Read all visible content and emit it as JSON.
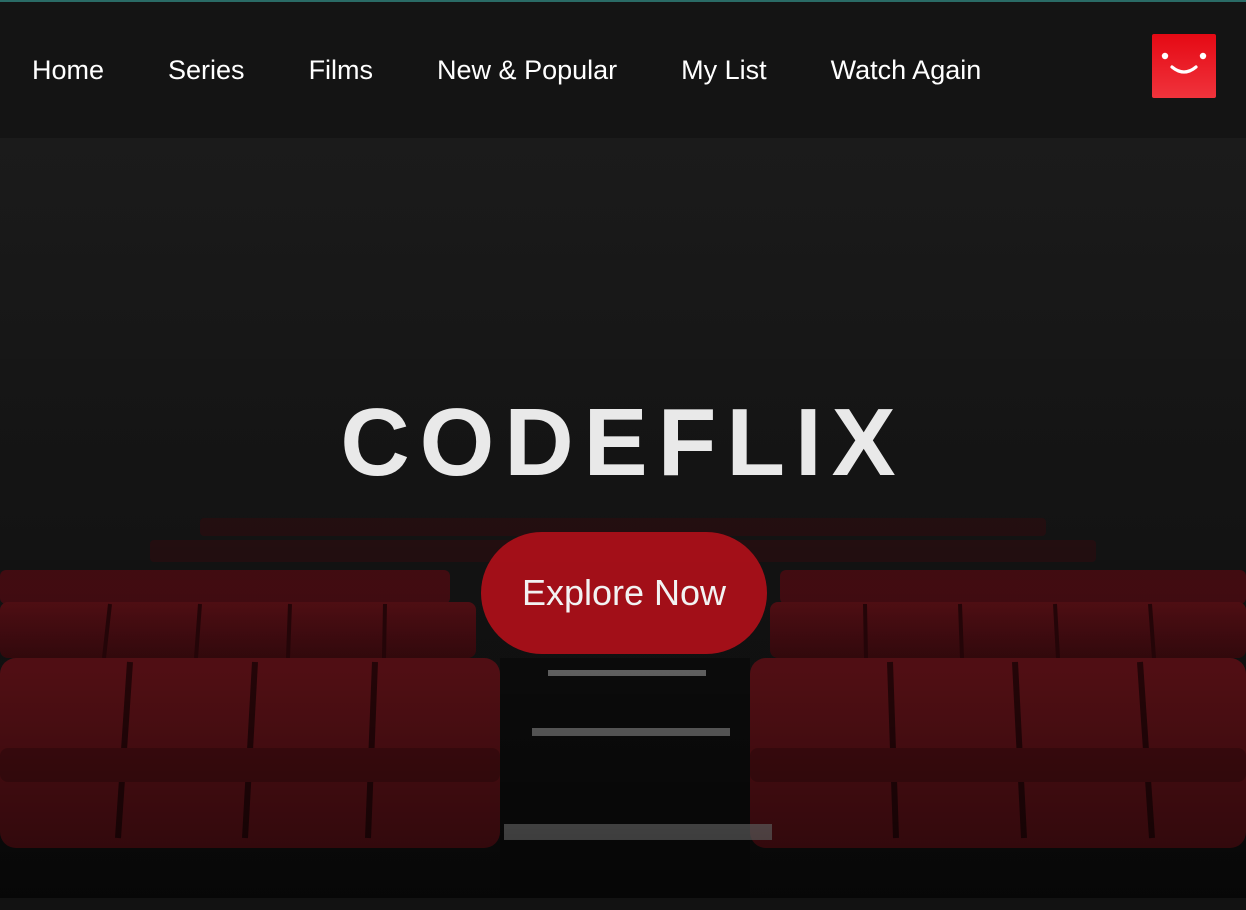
{
  "nav": {
    "links": [
      "Home",
      "Series",
      "Films",
      "New & Popular",
      "My List",
      "Watch Again"
    ]
  },
  "profile": {
    "icon": "smiley-avatar-icon"
  },
  "hero": {
    "title": "CODEFLIX",
    "cta_label": "Explore Now",
    "background": "cinema-seats-image"
  },
  "colors": {
    "accent": "#e50914",
    "cta": "#af0f19",
    "background": "#141414",
    "seat": "#6a1218"
  }
}
